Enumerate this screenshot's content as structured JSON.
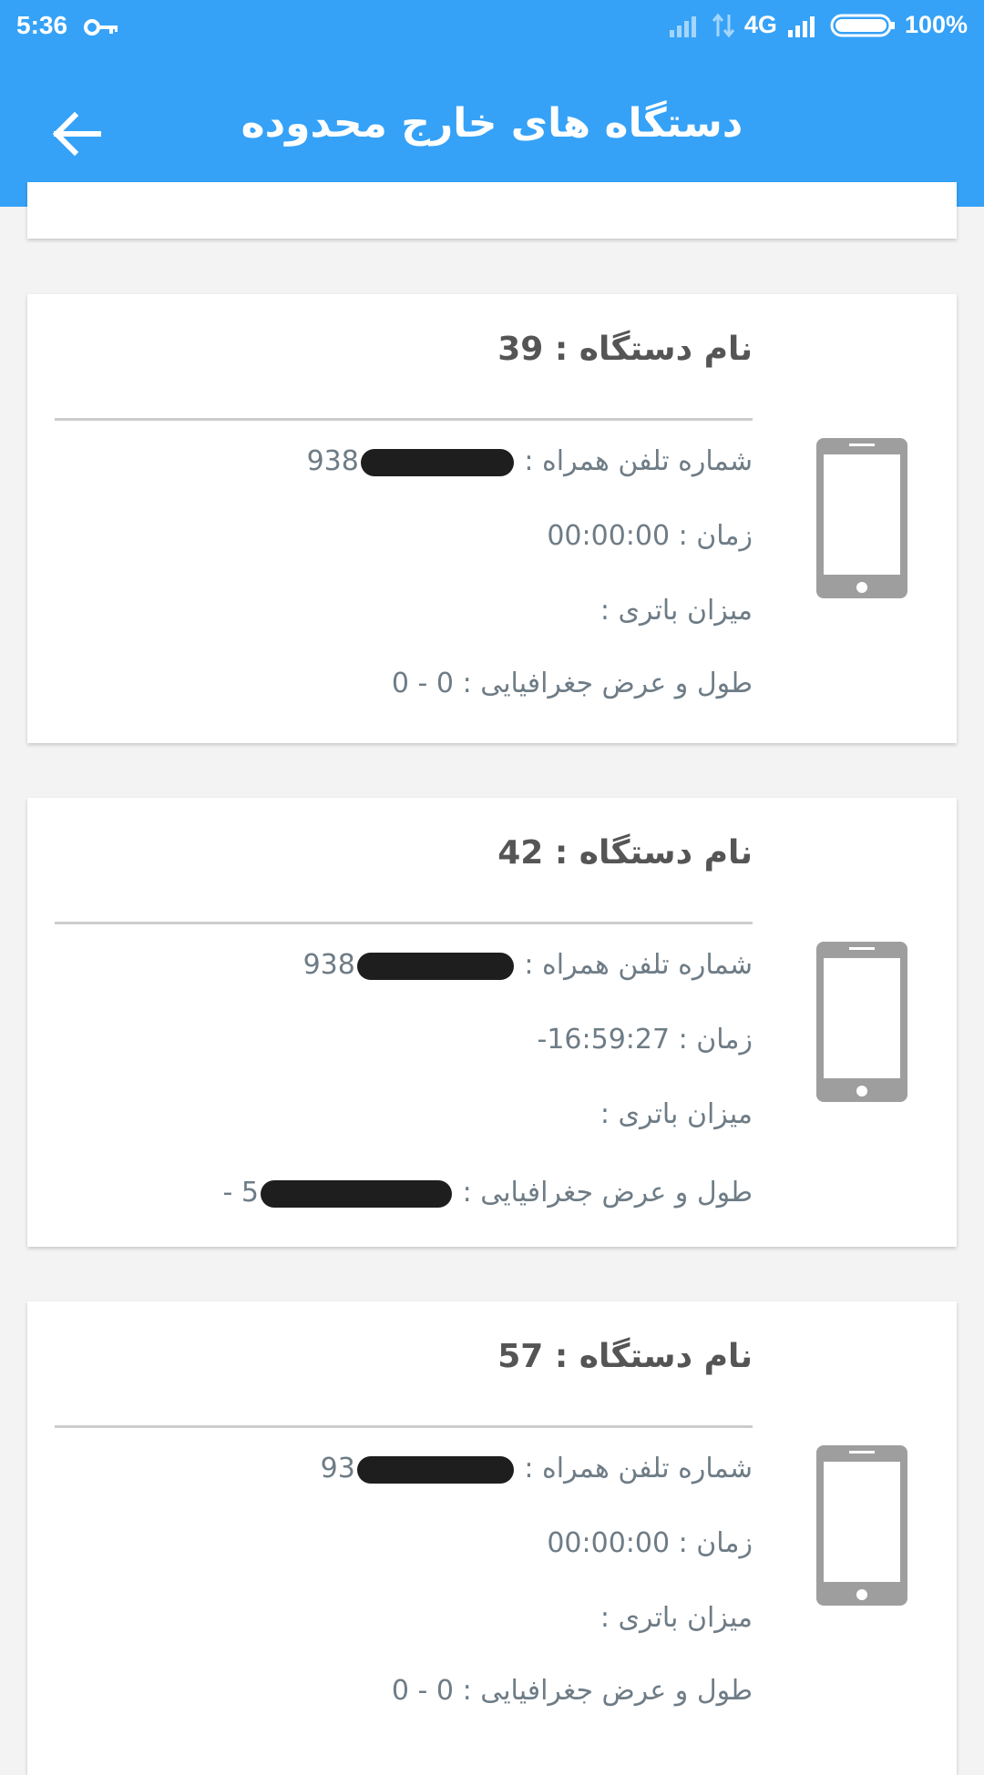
{
  "status_bar": {
    "time": "5:36",
    "network": "4G",
    "battery": "100%"
  },
  "toolbar": {
    "title": "دستگاه های خارج محدوده"
  },
  "devices": [
    {
      "title": "نام دستگاه : 39",
      "phone_label": "شماره تلفن همراه :",
      "phone_prefix": "938",
      "time": "زمان : 00:00:00",
      "battery": "میزان باتری :",
      "location_label": "طول و عرض جغرافیایی :",
      "location_value": "0 - 0"
    },
    {
      "title": "نام دستگاه : 42",
      "phone_label": "شماره تلفن همراه :",
      "phone_prefix": "938",
      "time": "زمان : 16:59:27-",
      "battery": "میزان باتری :",
      "location_label": "طول و عرض جغرافیایی :",
      "location_value": "5",
      "location_suffix": "-"
    },
    {
      "title": "نام دستگاه : 57",
      "phone_label": "شماره تلفن همراه :",
      "phone_prefix": "93",
      "time": "زمان : 00:00:00",
      "battery": "میزان باتری :",
      "location_label": "طول و عرض جغرافیایی :",
      "location_value": "0 - 0"
    }
  ],
  "icons": {
    "back": "arrow-back-icon",
    "device": "smartphone-icon",
    "key": "key-icon"
  },
  "colors": {
    "primary": "#35a2f7",
    "card_text": "#6e7c86",
    "title_text": "#555555",
    "icon": "#9e9e9e",
    "background": "#f3f3f3"
  }
}
